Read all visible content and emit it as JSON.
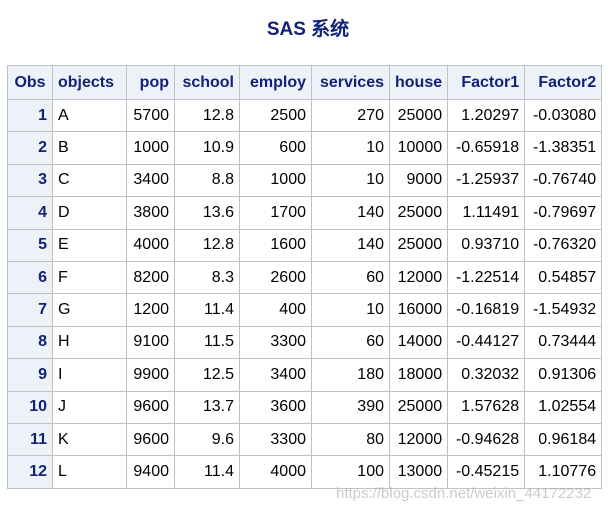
{
  "title": "SAS 系统",
  "columns": [
    "Obs",
    "objects",
    "pop",
    "school",
    "employ",
    "services",
    "house",
    "Factor1",
    "Factor2"
  ],
  "rows": [
    {
      "obs": "1",
      "objects": "A",
      "pop": "5700",
      "school": "12.8",
      "employ": "2500",
      "services": "270",
      "house": "25000",
      "factor1": "1.20297",
      "factor2": "-0.03080"
    },
    {
      "obs": "2",
      "objects": "B",
      "pop": "1000",
      "school": "10.9",
      "employ": "600",
      "services": "10",
      "house": "10000",
      "factor1": "-0.65918",
      "factor2": "-1.38351"
    },
    {
      "obs": "3",
      "objects": "C",
      "pop": "3400",
      "school": "8.8",
      "employ": "1000",
      "services": "10",
      "house": "9000",
      "factor1": "-1.25937",
      "factor2": "-0.76740"
    },
    {
      "obs": "4",
      "objects": "D",
      "pop": "3800",
      "school": "13.6",
      "employ": "1700",
      "services": "140",
      "house": "25000",
      "factor1": "1.11491",
      "factor2": "-0.79697"
    },
    {
      "obs": "5",
      "objects": "E",
      "pop": "4000",
      "school": "12.8",
      "employ": "1600",
      "services": "140",
      "house": "25000",
      "factor1": "0.93710",
      "factor2": "-0.76320"
    },
    {
      "obs": "6",
      "objects": "F",
      "pop": "8200",
      "school": "8.3",
      "employ": "2600",
      "services": "60",
      "house": "12000",
      "factor1": "-1.22514",
      "factor2": "0.54857"
    },
    {
      "obs": "7",
      "objects": "G",
      "pop": "1200",
      "school": "11.4",
      "employ": "400",
      "services": "10",
      "house": "16000",
      "factor1": "-0.16819",
      "factor2": "-1.54932"
    },
    {
      "obs": "8",
      "objects": "H",
      "pop": "9100",
      "school": "11.5",
      "employ": "3300",
      "services": "60",
      "house": "14000",
      "factor1": "-0.44127",
      "factor2": "0.73444"
    },
    {
      "obs": "9",
      "objects": "I",
      "pop": "9900",
      "school": "12.5",
      "employ": "3400",
      "services": "180",
      "house": "18000",
      "factor1": "0.32032",
      "factor2": "0.91306"
    },
    {
      "obs": "10",
      "objects": "J",
      "pop": "9600",
      "school": "13.7",
      "employ": "3600",
      "services": "390",
      "house": "25000",
      "factor1": "1.57628",
      "factor2": "1.02554"
    },
    {
      "obs": "11",
      "objects": "K",
      "pop": "9600",
      "school": "9.6",
      "employ": "3300",
      "services": "80",
      "house": "12000",
      "factor1": "-0.94628",
      "factor2": "0.96184"
    },
    {
      "obs": "12",
      "objects": "L",
      "pop": "9400",
      "school": "11.4",
      "employ": "4000",
      "services": "100",
      "house": "13000",
      "factor1": "-0.45215",
      "factor2": "1.10776"
    }
  ],
  "watermark": "https://blog.csdn.net/weixin_44172232",
  "colors": {
    "header_text": "#112277",
    "header_bg": "#edf2f9",
    "border": "#c1c1c1"
  }
}
